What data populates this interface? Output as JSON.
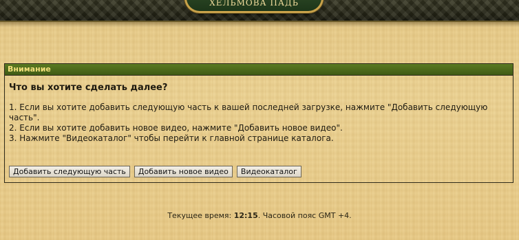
{
  "header": {
    "logo_text": "ХЕЛЬМОВА ПАДЬ"
  },
  "panel": {
    "title": "Внимание",
    "question": "Что вы хотите сделать далее?",
    "lines": [
      "1. Если вы хотите добавить следующую часть к вашей последней загрузке, нажмите \"Добавить следующую часть\".",
      "2. Если вы хотите добавить новое видео, нажмите \"Добавить новое видео\".",
      "3. Нажмите \"Видеокаталог\" чтобы перейти к главной странице каталога."
    ],
    "buttons": {
      "add_next_part": "Добавить следующую часть",
      "add_new_video": "Добавить новое видео",
      "video_catalog": "Видеокаталог"
    }
  },
  "footer": {
    "prefix": "Текущее время: ",
    "time": "12:15",
    "suffix": ". Часовой пояс GMT +4."
  },
  "colors": {
    "panel_header": "#4b6a1a",
    "panel_title_text": "#f3e07a",
    "parchment": "#e9cd8b"
  }
}
